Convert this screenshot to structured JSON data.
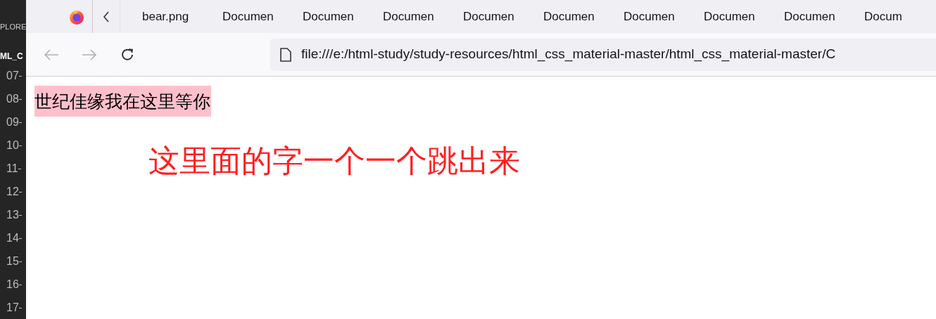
{
  "editor": {
    "explorer_label": "PLORE",
    "folder_label": "ML_C",
    "line_numbers": [
      "07",
      "08",
      "09",
      "10",
      "11",
      "12",
      "13",
      "14",
      "15",
      "16",
      "17"
    ]
  },
  "tabs": [
    {
      "label": "bear.png",
      "selected": false
    },
    {
      "label": "Documen",
      "selected": false
    },
    {
      "label": "Documen",
      "selected": false
    },
    {
      "label": "Documen",
      "selected": false
    },
    {
      "label": "Documen",
      "selected": false
    },
    {
      "label": "Documen",
      "selected": false
    },
    {
      "label": "Documen",
      "selected": false
    },
    {
      "label": "Documen",
      "selected": false
    },
    {
      "label": "Documen",
      "selected": false
    },
    {
      "label": "Docum",
      "selected": false
    }
  ],
  "address_bar": {
    "value": "file:///e:/html-study/study-resources/html_css_material-master/html_css_material-master/C"
  },
  "page": {
    "highlighted_text": "世纪佳缘我在这里等你",
    "heading": "这里面的字一个一个跳出来"
  }
}
